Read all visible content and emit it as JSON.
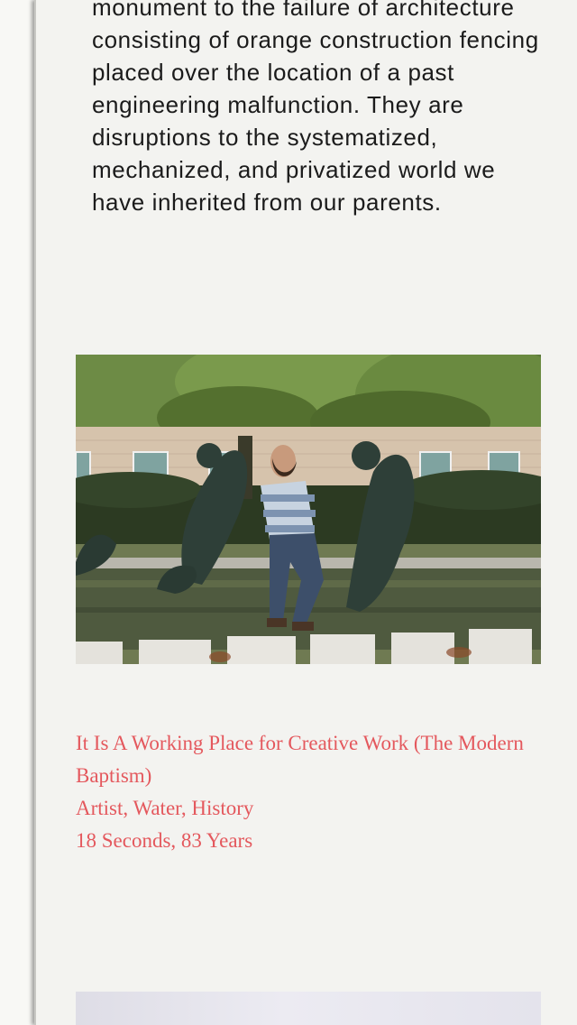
{
  "intro": {
    "text": "monument to the failure of architecture consisting of orange construction fencing placed over the location of a past engineering malfunction. They are disruptions to the systematized, mechanized, and privatized world we have inherited from our parents."
  },
  "artwork": {
    "image_icon": "photo-bearded-man-leaning-by-fountain-sculptures",
    "title": "It Is A Working Place for Creative Work (The Modern Baptism)",
    "tags": "Artist, Water, History",
    "duration": "18 Seconds, 83 Years"
  },
  "colors": {
    "caption": "#e4585d",
    "panel": "#f3f3f0"
  }
}
